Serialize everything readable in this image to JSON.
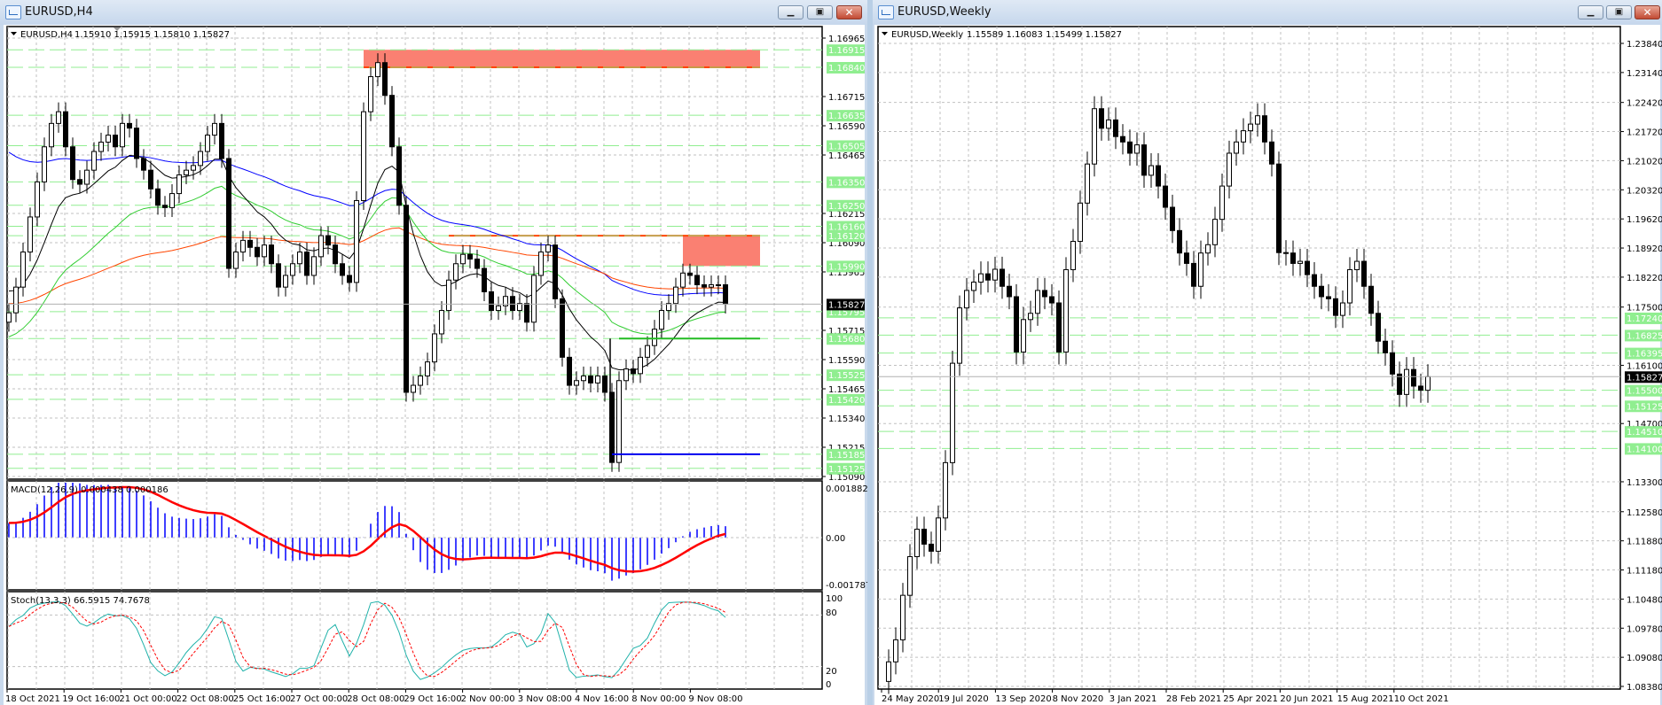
{
  "colors": {
    "level": "#90ee90",
    "zone": "#fa8072",
    "zone_line": "#ff4500",
    "bull": "#ffffff",
    "bear": "#000000",
    "ma_blue": "#0000ff",
    "ma_black": "#000000",
    "ma_green": "#32cd32",
    "ma_orange": "#ff4500",
    "macd_hist": "#0000ff",
    "macd_signal": "#ff0000",
    "stoch_k": "#20b2aa",
    "stoch_d": "#ff0000",
    "hline_green": "#22bb22",
    "hline_blue": "#0000ee"
  },
  "left": {
    "window_title": "EURUSD,H4",
    "header": {
      "symbol": "EURUSD,H4",
      "ohlc": "1.15910 1.15915 1.15810 1.15827"
    },
    "macd_label": "MACD(12,26,9) 0.000438 0.000186",
    "stoch_label": "Stoch(13,3,3) 66.5915 74.7678",
    "current_price": "1.15827",
    "price_ticks": [
      "1.16965",
      "1.16715",
      "1.16590",
      "1.16465",
      "1.16215",
      "1.16090",
      "1.15965",
      "1.15715",
      "1.15590",
      "1.15465",
      "1.15340",
      "1.15215",
      "1.15090"
    ],
    "levels": [
      "1.16915",
      "1.16840",
      "1.16635",
      "1.16505",
      "1.16350",
      "1.16250",
      "1.16160",
      "1.16120",
      "1.15990",
      "1.15795",
      "1.15680",
      "1.15525",
      "1.15420",
      "1.15185",
      "1.15125"
    ],
    "macd_ticks": [
      "0.001882",
      "0.00",
      "-0.001787"
    ],
    "stoch_ticks": [
      "100",
      "80",
      "20",
      "0"
    ],
    "time_labels": [
      "18 Oct 2021",
      "19 Oct 16:00",
      "21 Oct 00:00",
      "22 Oct 08:00",
      "25 Oct 16:00",
      "27 Oct 00:00",
      "28 Oct 08:00",
      "29 Oct 16:00",
      "2 Nov 00:00",
      "3 Nov 08:00",
      "4 Nov 16:00",
      "8 Nov 00:00",
      "9 Nov 08:00"
    ]
  },
  "right": {
    "window_title": "EURUSD,Weekly",
    "header": {
      "symbol": "EURUSD,Weekly",
      "ohlc": "1.15589 1.16083 1.15499 1.15827"
    },
    "current_price": "1.15827",
    "price_ticks": [
      "1.23840",
      "1.23140",
      "1.22420",
      "1.21720",
      "1.21020",
      "1.20320",
      "1.19620",
      "1.18920",
      "1.18220",
      "1.17500",
      "1.16100",
      "1.14700",
      "1.13300",
      "1.12580",
      "1.11880",
      "1.11180",
      "1.10480",
      "1.09780",
      "1.09080",
      "1.08380"
    ],
    "levels": [
      "1.17240",
      "1.16825",
      "1.16395",
      "1.15500",
      "1.15125",
      "1.14510",
      "1.14100"
    ],
    "time_labels": [
      "24 May 2020",
      "19 Jul 2020",
      "13 Sep 2020",
      "8 Nov 2020",
      "3 Jan 2021",
      "28 Feb 2021",
      "25 Apr 2021",
      "20 Jun 2021",
      "15 Aug 2021",
      "10 Oct 2021"
    ]
  },
  "chart_data": [
    {
      "type": "candlestick",
      "title": "EURUSD,H4",
      "ylim": [
        1.1509,
        1.16965
      ],
      "open0": 1.1575,
      "wick": 0.0004,
      "close": [
        1.1579,
        1.159,
        1.1605,
        1.162,
        1.1635,
        1.165,
        1.166,
        1.1665,
        1.165,
        1.1636,
        1.1634,
        1.164,
        1.1648,
        1.1652,
        1.1655,
        1.165,
        1.166,
        1.1658,
        1.1645,
        1.164,
        1.1632,
        1.1625,
        1.1624,
        1.163,
        1.1638,
        1.164,
        1.1642,
        1.1648,
        1.1655,
        1.166,
        1.1645,
        1.1598,
        1.1605,
        1.161,
        1.1607,
        1.1603,
        1.1608,
        1.16,
        1.159,
        1.1595,
        1.16,
        1.1605,
        1.1595,
        1.1603,
        1.1612,
        1.1608,
        1.16,
        1.1595,
        1.1592,
        1.1627,
        1.1665,
        1.168,
        1.1686,
        1.1672,
        1.165,
        1.1625,
        1.1545,
        1.1548,
        1.1552,
        1.1558,
        1.157,
        1.158,
        1.1593,
        1.16,
        1.1604,
        1.1602,
        1.1598,
        1.1588,
        1.158,
        1.1582,
        1.1586,
        1.158,
        1.1583,
        1.1575,
        1.1595,
        1.1605,
        1.1608,
        1.1585,
        1.156,
        1.1548,
        1.155,
        1.1552,
        1.1549,
        1.1552,
        1.1545,
        1.1515,
        1.155,
        1.1555,
        1.1553,
        1.156,
        1.1565,
        1.1572,
        1.158,
        1.1583,
        1.159,
        1.1596,
        1.1595,
        1.1591,
        1.159,
        1.1591,
        1.1591,
        1.15827
      ],
      "moving_averages": [
        {
          "color": "ma_blue",
          "period": 60,
          "seed": 1.165
        },
        {
          "color": "ma_orange",
          "period": 90,
          "seed": 1.1583
        },
        {
          "color": "ma_green",
          "period": 30,
          "seed": 1.1568
        },
        {
          "color": "ma_black",
          "period": 12,
          "seed": 1.159
        }
      ],
      "zones": [
        {
          "top": 1.16915,
          "bottom": 1.1684,
          "from_bar": 50
        },
        {
          "top": 1.1612,
          "bottom": 1.1599,
          "from_bar": 95
        }
      ],
      "zone_line": {
        "price": 1.1612,
        "from_bar": 62
      },
      "hlines": [
        {
          "price": 1.1568,
          "from_bar": 86,
          "color": "hline_green"
        },
        {
          "price": 1.15185,
          "from_bar": 85,
          "color": "hline_blue"
        }
      ],
      "macd": {
        "fast": 12,
        "slow": 26,
        "signal": 9,
        "ylim": [
          -0.001787,
          0.001882
        ]
      },
      "stoch": {
        "k": 13,
        "d": 3,
        "slowing": 3,
        "ylim": [
          0,
          100
        ]
      }
    },
    {
      "type": "candlestick",
      "title": "EURUSD,Weekly",
      "ylim": [
        1.0838,
        1.2384
      ],
      "open0": 1.085,
      "wick": 0.003,
      "close": [
        1.0897,
        1.095,
        1.1057,
        1.115,
        1.1216,
        1.118,
        1.1163,
        1.1243,
        1.1376,
        1.1615,
        1.1748,
        1.179,
        1.181,
        1.183,
        1.1815,
        1.1841,
        1.18,
        1.1775,
        1.1642,
        1.172,
        1.1735,
        1.179,
        1.1775,
        1.176,
        1.1642,
        1.184,
        1.1908,
        1.2,
        1.2094,
        1.2227,
        1.218,
        1.22,
        1.216,
        1.2147,
        1.212,
        1.214,
        1.2067,
        1.209,
        1.2041,
        1.199,
        1.1934,
        1.188,
        1.1855,
        1.18,
        1.188,
        1.19,
        1.1961,
        1.2041,
        1.212,
        1.2147,
        1.2174,
        1.219,
        1.221,
        1.2147,
        1.2094,
        1.1881,
        1.188,
        1.1855,
        1.186,
        1.1828,
        1.18,
        1.1775,
        1.177,
        1.173,
        1.176,
        1.184,
        1.186,
        1.18,
        1.1735,
        1.1668,
        1.164,
        1.1589,
        1.154,
        1.16,
        1.156,
        1.155,
        1.15827
      ]
    }
  ]
}
